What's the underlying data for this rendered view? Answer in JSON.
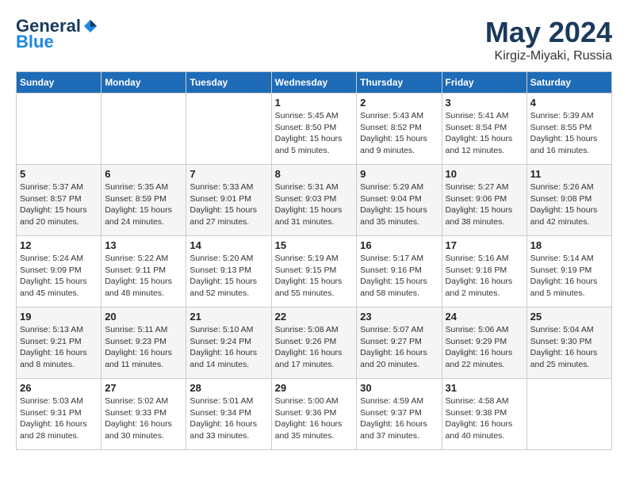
{
  "header": {
    "logo_general": "General",
    "logo_blue": "Blue",
    "title": "May 2024",
    "location": "Kirgiz-Miyaki, Russia"
  },
  "days_of_week": [
    "Sunday",
    "Monday",
    "Tuesday",
    "Wednesday",
    "Thursday",
    "Friday",
    "Saturday"
  ],
  "weeks": [
    [
      {
        "day": "",
        "info": ""
      },
      {
        "day": "",
        "info": ""
      },
      {
        "day": "",
        "info": ""
      },
      {
        "day": "1",
        "info": "Sunrise: 5:45 AM\nSunset: 8:50 PM\nDaylight: 15 hours\nand 5 minutes."
      },
      {
        "day": "2",
        "info": "Sunrise: 5:43 AM\nSunset: 8:52 PM\nDaylight: 15 hours\nand 9 minutes."
      },
      {
        "day": "3",
        "info": "Sunrise: 5:41 AM\nSunset: 8:54 PM\nDaylight: 15 hours\nand 12 minutes."
      },
      {
        "day": "4",
        "info": "Sunrise: 5:39 AM\nSunset: 8:55 PM\nDaylight: 15 hours\nand 16 minutes."
      }
    ],
    [
      {
        "day": "5",
        "info": "Sunrise: 5:37 AM\nSunset: 8:57 PM\nDaylight: 15 hours\nand 20 minutes."
      },
      {
        "day": "6",
        "info": "Sunrise: 5:35 AM\nSunset: 8:59 PM\nDaylight: 15 hours\nand 24 minutes."
      },
      {
        "day": "7",
        "info": "Sunrise: 5:33 AM\nSunset: 9:01 PM\nDaylight: 15 hours\nand 27 minutes."
      },
      {
        "day": "8",
        "info": "Sunrise: 5:31 AM\nSunset: 9:03 PM\nDaylight: 15 hours\nand 31 minutes."
      },
      {
        "day": "9",
        "info": "Sunrise: 5:29 AM\nSunset: 9:04 PM\nDaylight: 15 hours\nand 35 minutes."
      },
      {
        "day": "10",
        "info": "Sunrise: 5:27 AM\nSunset: 9:06 PM\nDaylight: 15 hours\nand 38 minutes."
      },
      {
        "day": "11",
        "info": "Sunrise: 5:26 AM\nSunset: 9:08 PM\nDaylight: 15 hours\nand 42 minutes."
      }
    ],
    [
      {
        "day": "12",
        "info": "Sunrise: 5:24 AM\nSunset: 9:09 PM\nDaylight: 15 hours\nand 45 minutes."
      },
      {
        "day": "13",
        "info": "Sunrise: 5:22 AM\nSunset: 9:11 PM\nDaylight: 15 hours\nand 48 minutes."
      },
      {
        "day": "14",
        "info": "Sunrise: 5:20 AM\nSunset: 9:13 PM\nDaylight: 15 hours\nand 52 minutes."
      },
      {
        "day": "15",
        "info": "Sunrise: 5:19 AM\nSunset: 9:15 PM\nDaylight: 15 hours\nand 55 minutes."
      },
      {
        "day": "16",
        "info": "Sunrise: 5:17 AM\nSunset: 9:16 PM\nDaylight: 15 hours\nand 58 minutes."
      },
      {
        "day": "17",
        "info": "Sunrise: 5:16 AM\nSunset: 9:18 PM\nDaylight: 16 hours\nand 2 minutes."
      },
      {
        "day": "18",
        "info": "Sunrise: 5:14 AM\nSunset: 9:19 PM\nDaylight: 16 hours\nand 5 minutes."
      }
    ],
    [
      {
        "day": "19",
        "info": "Sunrise: 5:13 AM\nSunset: 9:21 PM\nDaylight: 16 hours\nand 8 minutes."
      },
      {
        "day": "20",
        "info": "Sunrise: 5:11 AM\nSunset: 9:23 PM\nDaylight: 16 hours\nand 11 minutes."
      },
      {
        "day": "21",
        "info": "Sunrise: 5:10 AM\nSunset: 9:24 PM\nDaylight: 16 hours\nand 14 minutes."
      },
      {
        "day": "22",
        "info": "Sunrise: 5:08 AM\nSunset: 9:26 PM\nDaylight: 16 hours\nand 17 minutes."
      },
      {
        "day": "23",
        "info": "Sunrise: 5:07 AM\nSunset: 9:27 PM\nDaylight: 16 hours\nand 20 minutes."
      },
      {
        "day": "24",
        "info": "Sunrise: 5:06 AM\nSunset: 9:29 PM\nDaylight: 16 hours\nand 22 minutes."
      },
      {
        "day": "25",
        "info": "Sunrise: 5:04 AM\nSunset: 9:30 PM\nDaylight: 16 hours\nand 25 minutes."
      }
    ],
    [
      {
        "day": "26",
        "info": "Sunrise: 5:03 AM\nSunset: 9:31 PM\nDaylight: 16 hours\nand 28 minutes."
      },
      {
        "day": "27",
        "info": "Sunrise: 5:02 AM\nSunset: 9:33 PM\nDaylight: 16 hours\nand 30 minutes."
      },
      {
        "day": "28",
        "info": "Sunrise: 5:01 AM\nSunset: 9:34 PM\nDaylight: 16 hours\nand 33 minutes."
      },
      {
        "day": "29",
        "info": "Sunrise: 5:00 AM\nSunset: 9:36 PM\nDaylight: 16 hours\nand 35 minutes."
      },
      {
        "day": "30",
        "info": "Sunrise: 4:59 AM\nSunset: 9:37 PM\nDaylight: 16 hours\nand 37 minutes."
      },
      {
        "day": "31",
        "info": "Sunrise: 4:58 AM\nSunset: 9:38 PM\nDaylight: 16 hours\nand 40 minutes."
      },
      {
        "day": "",
        "info": ""
      }
    ]
  ]
}
